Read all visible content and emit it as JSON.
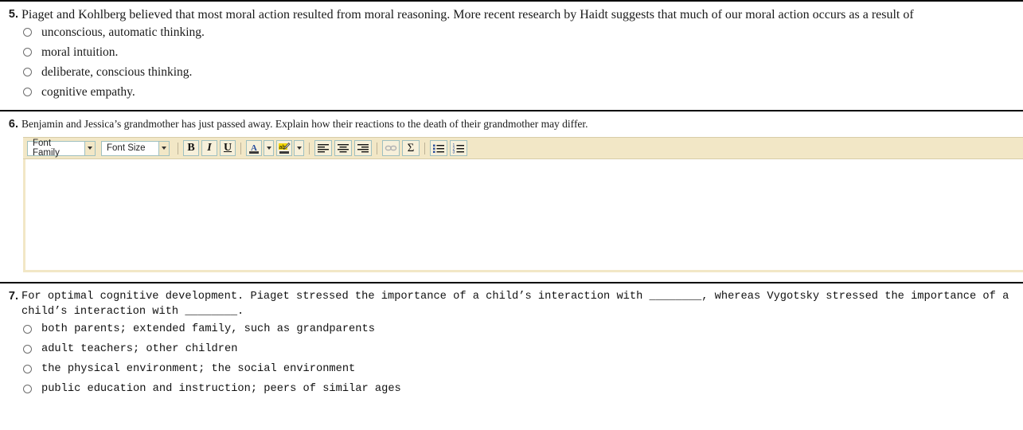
{
  "questions": [
    {
      "number": "5.",
      "prompt": "Piaget and Kohlberg believed that most moral action resulted from moral reasoning. More recent research by Haidt suggests that much of our moral action occurs as a result of",
      "options": [
        "unconscious, automatic thinking.",
        "moral intuition.",
        "deliberate, conscious thinking.",
        "cognitive empathy."
      ]
    },
    {
      "number": "6.",
      "prompt": "Benjamin and Jessica’s grandmother has just passed away. Explain how their reactions to the death of their grandmother may differ.",
      "editor": {
        "font_family_value": "Font Family",
        "font_size_value": "Font Size",
        "answer_value": "",
        "buttons": {
          "bold": "B",
          "italic": "I",
          "underline": "U",
          "font_color": "A",
          "highlight": "ab",
          "align_left": "align-left",
          "align_center": "align-center",
          "align_right": "align-right",
          "insert_link": "link",
          "insert_equation": "Σ",
          "bullet_list": "bulleted-list",
          "numbered_list": "numbered-list"
        }
      }
    },
    {
      "number": "7.",
      "prompt": "For optimal cognitive development. Piaget stressed the importance of a child’s interaction with ________, whereas Vygotsky stressed the importance of a child’s interaction with ________.",
      "options": [
        "both parents; extended family, such as grandparents",
        "adult teachers; other children",
        "the physical environment; the social environment",
        "public education and instruction; peers of similar ages"
      ]
    }
  ],
  "colors": {
    "toolbar_background": "#f2e7c6",
    "toolbar_border": "#d8cda8",
    "button_border": "#9fc0c0",
    "divider": "#000000",
    "font_color_glyph": "#2b4f9e",
    "highlight_yellow": "#f2d600",
    "list_marker_blue": "#2b4f9e",
    "disabled_icon": "#b3b3b3"
  }
}
